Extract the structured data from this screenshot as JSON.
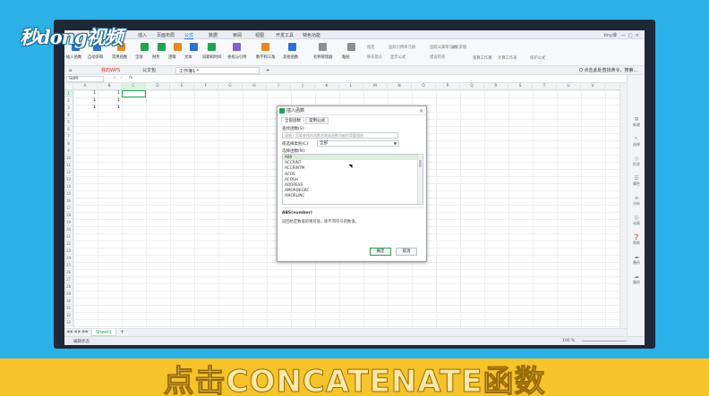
{
  "watermark": {
    "brand": "秒dong视频"
  },
  "caption": "点击CONCATENATE函数",
  "menu": {
    "tabs": [
      "插入",
      "页面布局",
      "公式",
      "数据",
      "审阅",
      "视图",
      "开发工具",
      "特色功能"
    ],
    "active_index": 2,
    "user": "tiny课",
    "icons": [
      "minimize-icon",
      "restore-icon",
      "close-icon"
    ]
  },
  "ribbon": {
    "items": [
      {
        "label": "插入函数",
        "color": "#2f6fce"
      },
      {
        "label": "自动求和",
        "color": "#2f6fce"
      },
      {
        "label": "常用函数",
        "color": "#e58a1f"
      },
      {
        "label": "全部",
        "color": "#1fa350"
      },
      {
        "label": "财务",
        "color": "#1fa350"
      },
      {
        "label": "逻辑",
        "color": "#e58a1f"
      },
      {
        "label": "文本",
        "color": "#2f6fce"
      },
      {
        "label": "日期和时间",
        "color": "#1fa350"
      },
      {
        "label": "查找与引用",
        "color": "#8a5bd1"
      },
      {
        "label": "数学和三角",
        "color": "#e58a1f"
      },
      {
        "label": "其他函数",
        "color": "#2f6fce"
      },
      {
        "label": "名称管理器",
        "color": "#8a8f97"
      },
      {
        "label": "粘贴",
        "color": "#8a8f97"
      }
    ],
    "right_items": [
      "指定",
      "追踪引用单元格",
      "追踪从属单元格",
      "移去箭头",
      "显示公式",
      "错误检查",
      "公式求值",
      "重算工作簿",
      "计算工作表",
      "保护公式"
    ]
  },
  "doctabs": {
    "tabs": [
      "我的WPS",
      "公文包",
      "工作簿1 *"
    ],
    "search": "Q 点击此处查找命令、搜索..."
  },
  "formula": {
    "namebox": "SUM",
    "fx": "fx"
  },
  "grid": {
    "columns": [
      "A",
      "B",
      "C",
      "D",
      "E",
      "F",
      "G",
      "H",
      "I",
      "J",
      "K",
      "L",
      "M",
      "N",
      "O",
      "P",
      "Q",
      "R",
      "S",
      "T",
      "U",
      "V"
    ],
    "rows": [
      "1",
      "2",
      "3",
      "4",
      "5",
      "6",
      "7",
      "8",
      "9",
      "10",
      "11",
      "12",
      "13",
      "14",
      "15",
      "16",
      "17",
      "18",
      "19",
      "20",
      "21",
      "22",
      "23",
      "24",
      "25",
      "26",
      "27",
      "28",
      "29",
      "30",
      "31",
      "32",
      "33"
    ],
    "values": [
      {
        "row": 0,
        "col": 0,
        "v": "1"
      },
      {
        "row": 0,
        "col": 1,
        "v": "1"
      },
      {
        "row": 1,
        "col": 0,
        "v": "1"
      },
      {
        "row": 1,
        "col": 1,
        "v": "1"
      },
      {
        "row": 2,
        "col": 0,
        "v": "1"
      },
      {
        "row": 2,
        "col": 1,
        "v": "1"
      }
    ],
    "active": "C1"
  },
  "sidepanel": [
    "新建",
    "选择",
    "形状",
    "属性",
    "分析",
    "动画",
    "帮助",
    "备份",
    "备份"
  ],
  "sheetbar": {
    "sheet": "Sheet1",
    "add": "+"
  },
  "status": {
    "left": "编辑状态",
    "zoom": "100 %"
  },
  "dialog": {
    "title": "插入函数",
    "tabs": [
      "全部函数",
      "常用公式"
    ],
    "search_label": "查找函数(S):",
    "search_placeholder": "请输入您要查找的函数名称或函数功能的简要描述",
    "category_label": "或选择类别(C):",
    "category_value": "全部",
    "list_label": "选择函数(N):",
    "functions": [
      "ABS",
      "ACCRINT",
      "ACCRINTM",
      "ACOS",
      "ACOSH",
      "ADDRESS",
      "AMORDEGRC",
      "AMORLINC"
    ],
    "selected_index": 0,
    "syntax": "ABS(number)",
    "description": "返回给定数值的绝对值，即不带符号的数值。",
    "ok": "确定",
    "cancel": "取消"
  }
}
